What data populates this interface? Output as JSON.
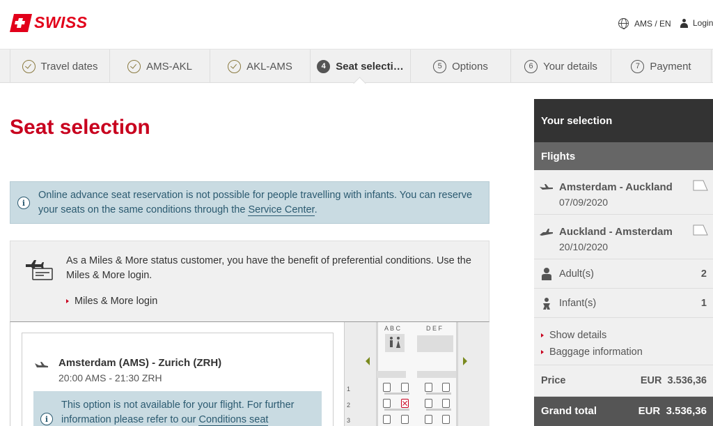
{
  "brand": {
    "name": "SWISS",
    "color": "#e2001a"
  },
  "header": {
    "language": "AMS / EN",
    "login": "Login"
  },
  "steps": [
    {
      "label": "Travel dates",
      "state": "done",
      "marker": ""
    },
    {
      "label": "AMS-AKL",
      "state": "done",
      "marker": ""
    },
    {
      "label": "AKL-AMS",
      "state": "done",
      "marker": ""
    },
    {
      "label": "Seat selecti…",
      "state": "active",
      "marker": "4"
    },
    {
      "label": "Options",
      "state": "todo",
      "marker": "5"
    },
    {
      "label": "Your details",
      "state": "todo",
      "marker": "6"
    },
    {
      "label": "Payment",
      "state": "todo",
      "marker": "7"
    }
  ],
  "page": {
    "title": "Seat selection"
  },
  "notice": {
    "text_before": "Online advance seat reservation is not possible for people travelling with infants. You can reserve your seats on the same conditions through the ",
    "link": "Service Center",
    "text_after": "."
  },
  "miles": {
    "text": "As a Miles & More status customer, you have the benefit of preferential conditions. Use the Miles & More login.",
    "link": "Miles & More login"
  },
  "flight_card": {
    "route": "Amsterdam (AMS) - Zurich (ZRH)",
    "time": "20:00 AMS - 21:30 ZRH",
    "info_before": "This option is not available for your flight. For further information please refer to our ",
    "info_link": "Conditions seat"
  },
  "seatmap": {
    "left_letters": "A B C",
    "right_letters": "D E F",
    "rows": [
      "1",
      "2",
      "3"
    ]
  },
  "sidebar": {
    "title": "Your selection",
    "flights_header": "Flights",
    "legs": [
      {
        "route": "Amsterdam - Auckland",
        "date": "07/09/2020"
      },
      {
        "route": "Auckland - Amsterdam",
        "date": "20/10/2020"
      }
    ],
    "pax": [
      {
        "label": "Adult(s)",
        "count": "2"
      },
      {
        "label": "Infant(s)",
        "count": "1"
      }
    ],
    "links": [
      "Show details",
      "Baggage information"
    ],
    "price_label": "Price",
    "price_value": "EUR  3.536,36",
    "total_label": "Grand total",
    "total_value": "EUR  3.536,36"
  }
}
